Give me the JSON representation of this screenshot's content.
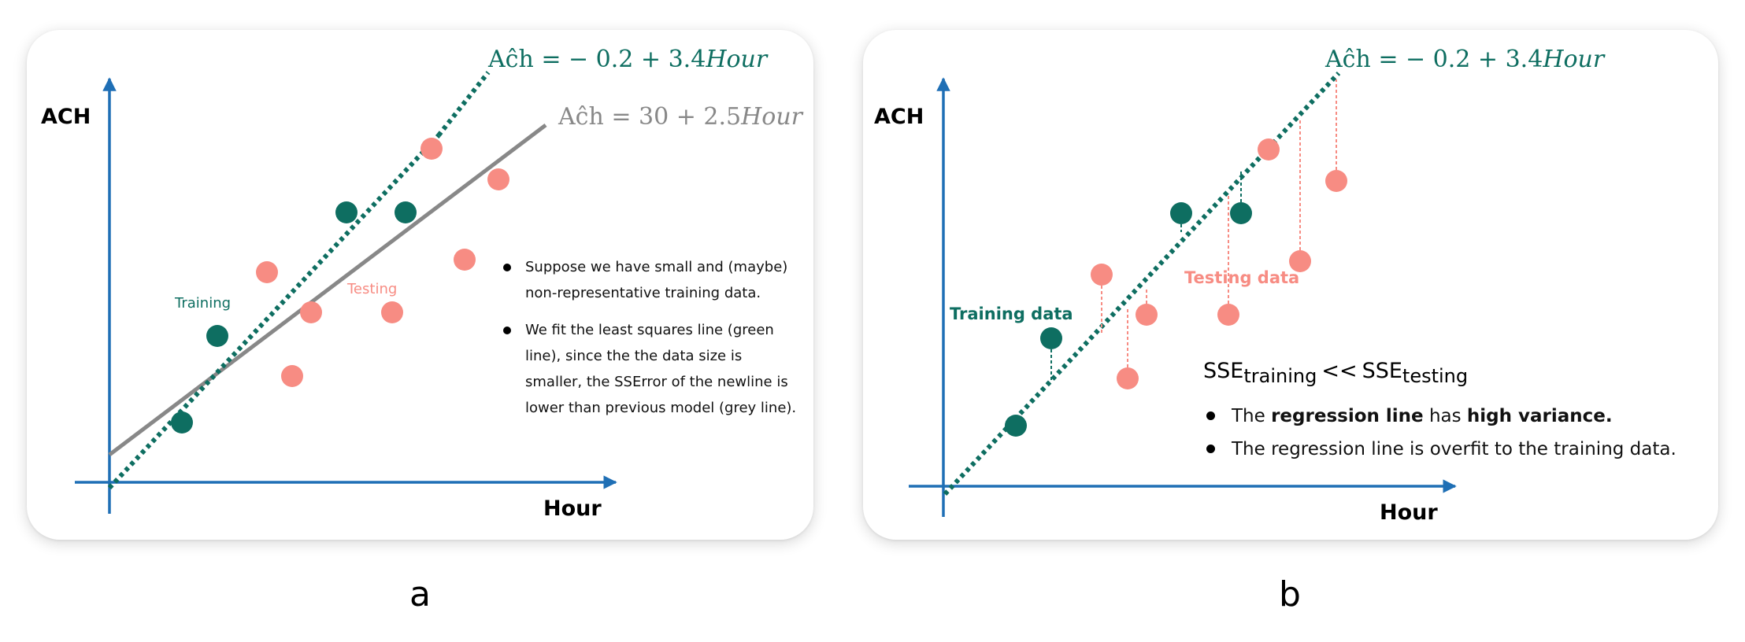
{
  "colors": {
    "training": "#0e6e61",
    "testing": "#f78c83",
    "axis": "#1f6fb5",
    "grey_line": "#888888"
  },
  "panel_a": {
    "y_axis_label": "ACH",
    "x_axis_label": "Hour",
    "green_equation": {
      "hat": "Aĉh",
      "rhs": " = − 0.2 + 3.4",
      "var": "Hour"
    },
    "grey_equation": {
      "hat": "Aĉh",
      "rhs": " = 30 + 2.5",
      "var": "Hour"
    },
    "training_label": "Training",
    "testing_label": "Testing",
    "notes": [
      "Suppose we have small and (maybe) non-representative training data.",
      "We fit the least squares line (green line), since the the data size is smaller, the SSError of the newline is lower than previous model (grey line)."
    ],
    "caption": "a"
  },
  "panel_b": {
    "y_axis_label": "ACH",
    "x_axis_label": "Hour",
    "green_equation": {
      "hat": "Aĉh",
      "rhs": " = − 0.2 + 3.4",
      "var": "Hour"
    },
    "training_label": "Training data",
    "testing_label": "Testing data",
    "sse": {
      "left": "SSE",
      "left_sub": "training",
      "op": "<<",
      "right": "SSE",
      "right_sub": "testing"
    },
    "bullet1": {
      "pre": "The ",
      "b1": "regression line",
      "mid": " has ",
      "b2": "high variance."
    },
    "bullet2": "The regression line is overfit to the training data.",
    "caption": "b"
  }
}
